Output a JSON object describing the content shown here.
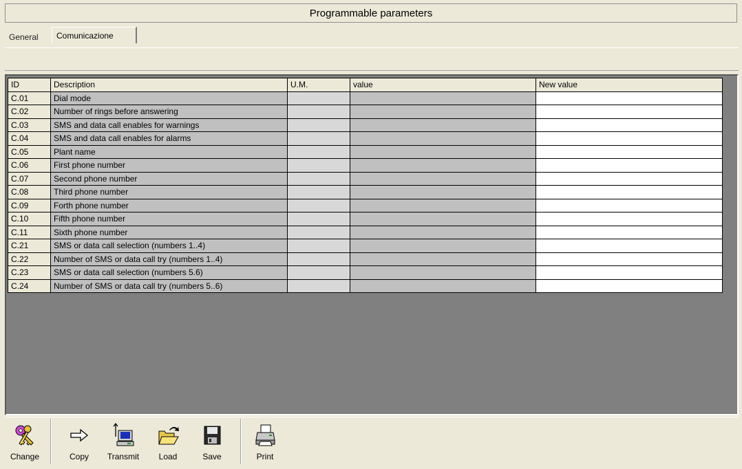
{
  "title": "Programmable parameters",
  "tabs": [
    {
      "label": "General"
    },
    {
      "label": "Comunicazione"
    }
  ],
  "table": {
    "headers": [
      "ID",
      "Description",
      "U.M.",
      "value",
      "New value"
    ],
    "rows": [
      {
        "id": "C.01",
        "desc": "Dial mode",
        "um": "",
        "value": "",
        "new": ""
      },
      {
        "id": "C.02",
        "desc": "Number of rings before answering",
        "um": "",
        "value": "",
        "new": ""
      },
      {
        "id": "C.03",
        "desc": "SMS and data call enables for warnings",
        "um": "",
        "value": "",
        "new": ""
      },
      {
        "id": "C.04",
        "desc": "SMS and data call enables for alarms",
        "um": "",
        "value": "",
        "new": ""
      },
      {
        "id": "C.05",
        "desc": "Plant name",
        "um": "",
        "value": "",
        "new": ""
      },
      {
        "id": "C.06",
        "desc": "First phone number",
        "um": "",
        "value": "",
        "new": ""
      },
      {
        "id": "C.07",
        "desc": "Second phone number",
        "um": "",
        "value": "",
        "new": ""
      },
      {
        "id": "C.08",
        "desc": "Third phone number",
        "um": "",
        "value": "",
        "new": ""
      },
      {
        "id": "C.09",
        "desc": "Forth phone number",
        "um": "",
        "value": "",
        "new": ""
      },
      {
        "id": "C.10",
        "desc": "Fifth phone number",
        "um": "",
        "value": "",
        "new": ""
      },
      {
        "id": "C.11",
        "desc": "Sixth phone number",
        "um": "",
        "value": "",
        "new": ""
      },
      {
        "id": "C.21",
        "desc": "SMS or data call selection (numbers 1..4)",
        "um": "",
        "value": "",
        "new": ""
      },
      {
        "id": "C.22",
        "desc": "Number of SMS or data call try (numbers 1..4)",
        "um": "",
        "value": "",
        "new": ""
      },
      {
        "id": "C.23",
        "desc": "SMS or data call selection (numbers 5.6)",
        "um": "",
        "value": "",
        "new": ""
      },
      {
        "id": "C.24",
        "desc": "Number of SMS or data call try (numbers 5..6)",
        "um": "",
        "value": "",
        "new": ""
      }
    ]
  },
  "toolbar": {
    "change": {
      "label": "Change",
      "icon": "keys-icon"
    },
    "copy": {
      "label": "Copy",
      "icon": "arrow-right-icon"
    },
    "transmit": {
      "label": "Transmit",
      "icon": "computer-transmit-icon"
    },
    "load": {
      "label": "Load",
      "icon": "open-folder-icon"
    },
    "save": {
      "label": "Save",
      "icon": "floppy-disk-icon"
    },
    "print": {
      "label": "Print",
      "icon": "printer-icon"
    }
  }
}
